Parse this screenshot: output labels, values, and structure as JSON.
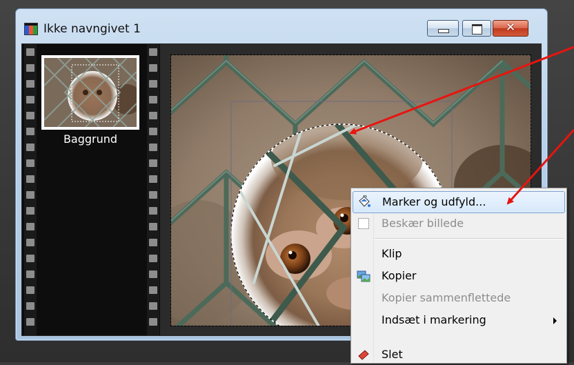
{
  "window": {
    "title": "Ikke navngivet 1",
    "buttons": {
      "minimize": "minimize",
      "maximize": "maximize",
      "close": "close"
    }
  },
  "layers": {
    "items": [
      {
        "label": "Baggrund"
      }
    ]
  },
  "context_menu": {
    "items": [
      {
        "label": "Marker og udfyld...",
        "icon": "paint-bucket-icon",
        "enabled": true,
        "highlighted": true
      },
      {
        "label": "Beskær billede",
        "icon": "crop-icon",
        "enabled": false
      },
      {
        "label": "Klip",
        "enabled": true
      },
      {
        "label": "Kopier",
        "icon": "copy-image-icon",
        "enabled": true
      },
      {
        "label": "Kopier sammenflettede",
        "enabled": false
      },
      {
        "label": "Indsæt i markering",
        "enabled": true,
        "submenu": true
      },
      {
        "label": "Slet",
        "icon": "eraser-icon",
        "enabled": true
      }
    ]
  },
  "colors": {
    "annotation_arrow": "#e8140f",
    "highlight_border": "#7da2ce",
    "window_frame": "#b9d1ea"
  }
}
